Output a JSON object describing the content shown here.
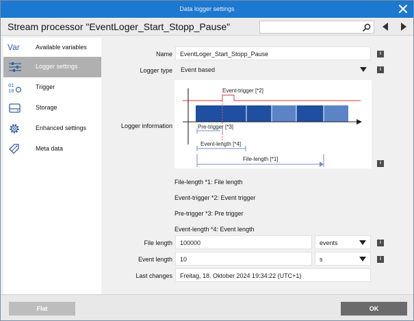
{
  "window": {
    "title": "Data logger settings",
    "close_icon": "close-icon"
  },
  "header": {
    "title": "Stream processor \"EventLoger_Start_Stopp_Pause\"",
    "search_placeholder": ""
  },
  "sidebar": {
    "items": [
      {
        "label": "Available variables",
        "icon": "Var",
        "active": false
      },
      {
        "label": "Logger settings",
        "icon": "sliders-icon",
        "active": true
      },
      {
        "label": "Trigger",
        "icon": "trigger-icon",
        "active": false
      },
      {
        "label": "Storage",
        "icon": "storage-icon",
        "active": false
      },
      {
        "label": "Enhanced settings",
        "icon": "gear-icon",
        "active": false
      },
      {
        "label": "Meta data",
        "icon": "tags-icon",
        "active": false
      }
    ]
  },
  "form": {
    "name_label": "Name",
    "name_value": "EventLoger_Start_Stopp_Pause",
    "logger_type_label": "Logger type",
    "logger_type_value": "Event based",
    "logger_info_label": "Logger information",
    "file_length_label": "File length",
    "file_length_value": "100000",
    "file_length_unit": "events",
    "event_length_label": "Event length",
    "event_length_value": "10",
    "event_length_unit": "s",
    "last_changes_label": "Last changes",
    "last_changes_value": "Freitag, 18. Oktober 2024   19:34:22 (UTC+1)",
    "info_glyph": "i"
  },
  "diagram": {
    "event_trigger": "Event-trigger [*2]",
    "pre_trigger": "Pre-trigger [*3]",
    "event_length": "Event-length [*4]",
    "file_length": "File-length [*1]"
  },
  "notes": [
    "File-length   *1: File length",
    "Event-trigger   *2: Event trigger",
    "Pre-trigger   *3: Pre trigger",
    "Event-length   *4: Event length"
  ],
  "footer": {
    "flat_label": "Flat",
    "ok_label": "OK"
  },
  "colors": {
    "titlebar": "#1d78cf",
    "segment_dark": "#1f4fa0",
    "segment_light": "#5b84c6",
    "trigger_line": "#e35a5a",
    "arrow": "#6f8fc9"
  }
}
